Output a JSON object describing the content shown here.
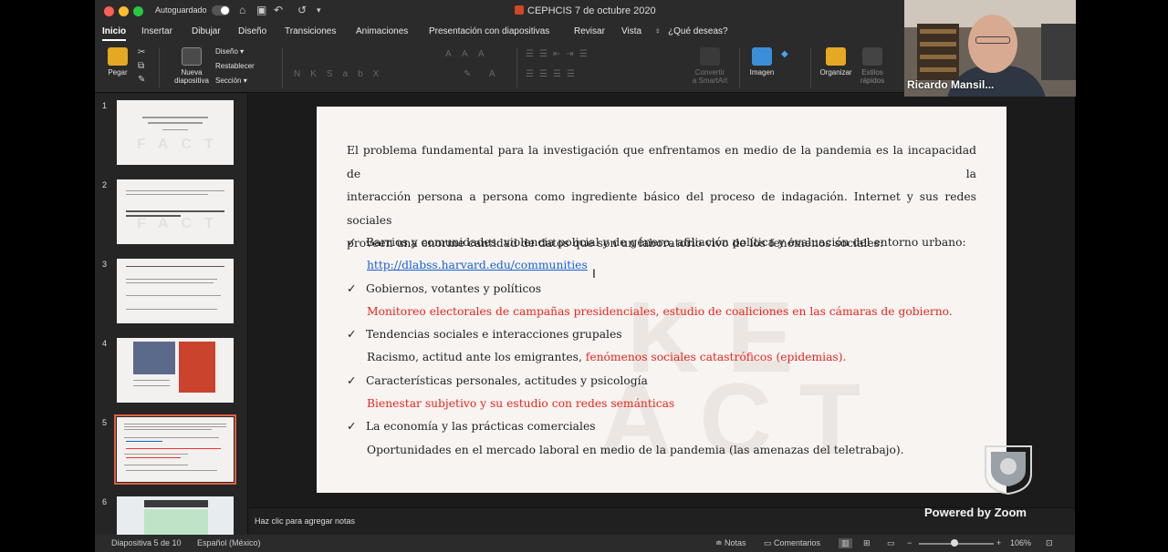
{
  "titlebar": {
    "autosave_label": "Autoguardado",
    "document_title": "CEPHCIS 7 de octubre 2020"
  },
  "ribbon_tabs": [
    "Inicio",
    "Insertar",
    "Dibujar",
    "Diseño",
    "Transiciones",
    "Animaciones",
    "Presentación con diapositivas",
    "Revisar",
    "Vista"
  ],
  "search": {
    "placeholder": "¿Qué deseas?"
  },
  "ribbon": {
    "paste": "Pegar",
    "new_slide_1": "Nueva",
    "new_slide_2": "diapositiva",
    "layout": "Diseño",
    "reset": "Restablecer",
    "section": "Sección",
    "smartart_1": "Convertir",
    "smartart_2": "a SmartArt",
    "image": "Imagen",
    "arrange": "Organizar",
    "quick_styles_1": "Estilos",
    "quick_styles_2": "rápidos"
  },
  "thumbnails": [
    {
      "num": "1"
    },
    {
      "num": "2"
    },
    {
      "num": "3"
    },
    {
      "num": "4"
    },
    {
      "num": "5"
    },
    {
      "num": "6"
    }
  ],
  "slide": {
    "intro_lines": [
      "El problema fundamental para la investigación que enfrentamos en medio de la pandemia es la incapacidad de la",
      "interacción persona a persona como ingrediente básico del proceso de indagación. Internet y sus redes sociales",
      "proveen una enorme cantidad de datos que son un laboratorio vivo de los fenómenos sociales:"
    ],
    "check": "✓",
    "b1": "Barrios y comunidades: violencia policial y de género, afiliación política y evaluación del entorno urbano:",
    "b1_link": "http://dlabss.harvard.edu/communities",
    "b2": "Gobiernos, votantes y políticos",
    "b2_sub": "Monitoreo electorales de campañas presidenciales, estudio de coaliciones en las cámaras de gobierno.",
    "b3": "Tendencias sociales e interacciones grupales",
    "b3_sub_black": "Racismo, actitud ante los emigrantes, ",
    "b3_sub_red": "fenómenos sociales catastróficos (epidemias).",
    "b4": "Características personales, actitudes y psicología",
    "b4_sub": "Bienestar subjetivo y su estudio con redes semánticas",
    "b5": "La economía y las prácticas comerciales",
    "b5_sub": "Oportunidades en el mercado laboral en medio de la pandemia (las amenazas del teletrabajo)."
  },
  "notes": {
    "placeholder": "Haz clic para agregar notas"
  },
  "overlay": {
    "powered_by": "Powered by Zoom"
  },
  "video": {
    "participant_name": "Ricardo Mansil..."
  },
  "statusbar": {
    "slide_info": "Diapositiva 5 de 10",
    "language": "Español (México)",
    "notes": "Notas",
    "comments": "Comentarios",
    "zoom": "106%"
  },
  "colors": {
    "accent_red": "#e8251c",
    "link_blue": "#1a5fd0",
    "selected_outline": "#e0603f"
  }
}
